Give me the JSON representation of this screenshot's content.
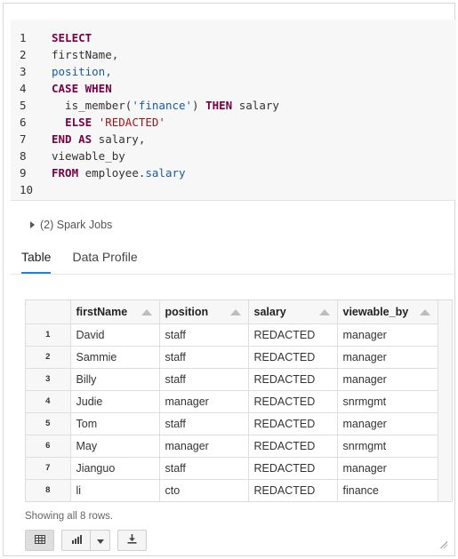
{
  "editor": {
    "lines": [
      {
        "n": "1",
        "tokens": [
          {
            "t": "SELECT",
            "c": "kw"
          }
        ]
      },
      {
        "n": "2",
        "tokens": [
          {
            "t": "firstName,",
            "c": "plain"
          }
        ]
      },
      {
        "n": "3",
        "tokens": [
          {
            "t": "position,",
            "c": "ident"
          }
        ]
      },
      {
        "n": "4",
        "tokens": [
          {
            "t": "CASE WHEN",
            "c": "kw"
          }
        ]
      },
      {
        "n": "5",
        "tokens": [
          {
            "t": "  is_member(",
            "c": "plain"
          },
          {
            "t": "'finance'",
            "c": "ident"
          },
          {
            "t": ") ",
            "c": "plain"
          },
          {
            "t": "THEN",
            "c": "kw"
          },
          {
            "t": " salary",
            "c": "plain"
          }
        ]
      },
      {
        "n": "6",
        "tokens": [
          {
            "t": "  ",
            "c": "plain"
          },
          {
            "t": "ELSE",
            "c": "kw"
          },
          {
            "t": " ",
            "c": "plain"
          },
          {
            "t": "'REDACTED'",
            "c": "str"
          }
        ]
      },
      {
        "n": "7",
        "tokens": [
          {
            "t": "END AS",
            "c": "kw"
          },
          {
            "t": " salary,",
            "c": "plain"
          }
        ]
      },
      {
        "n": "8",
        "tokens": [
          {
            "t": "viewable_by",
            "c": "plain"
          }
        ]
      },
      {
        "n": "9",
        "tokens": [
          {
            "t": "FROM",
            "c": "kw"
          },
          {
            "t": " employee.",
            "c": "plain"
          },
          {
            "t": "salary",
            "c": "ident"
          }
        ]
      },
      {
        "n": "10",
        "tokens": []
      }
    ]
  },
  "spark_jobs": {
    "label": "(2) Spark Jobs"
  },
  "tabs": [
    {
      "label": "Table",
      "active": true
    },
    {
      "label": "Data Profile",
      "active": false
    }
  ],
  "table": {
    "columns": [
      "firstName",
      "position",
      "salary",
      "viewable_by"
    ],
    "rows": [
      {
        "idx": "1",
        "cells": [
          "David",
          "staff",
          "REDACTED",
          "manager"
        ]
      },
      {
        "idx": "2",
        "cells": [
          "Sammie",
          "staff",
          "REDACTED",
          "manager"
        ]
      },
      {
        "idx": "3",
        "cells": [
          "Billy",
          "staff",
          "REDACTED",
          "manager"
        ]
      },
      {
        "idx": "4",
        "cells": [
          "Judie",
          "manager",
          "REDACTED",
          "snrmgmt"
        ]
      },
      {
        "idx": "5",
        "cells": [
          "Tom",
          "staff",
          "REDACTED",
          "manager"
        ]
      },
      {
        "idx": "6",
        "cells": [
          "May",
          "manager",
          "REDACTED",
          "snrmgmt"
        ]
      },
      {
        "idx": "7",
        "cells": [
          "Jianguo",
          "staff",
          "REDACTED",
          "manager"
        ]
      },
      {
        "idx": "8",
        "cells": [
          "li",
          "cto",
          "REDACTED",
          "finance"
        ]
      }
    ]
  },
  "footer": {
    "rows_info": "Showing all 8 rows."
  },
  "toolbar": {
    "buttons": [
      {
        "icon": "table-icon",
        "active": true
      },
      {
        "icon": "bar-chart-icon",
        "active": false
      },
      {
        "icon": "chevron-down-icon",
        "active": false
      },
      {
        "icon": "download-icon",
        "active": false
      }
    ]
  },
  "colors": {
    "keyword": "#7a0046",
    "string": "#a31515",
    "identifier": "#1a5aa6",
    "tab_underline": "#2c7cd3"
  }
}
